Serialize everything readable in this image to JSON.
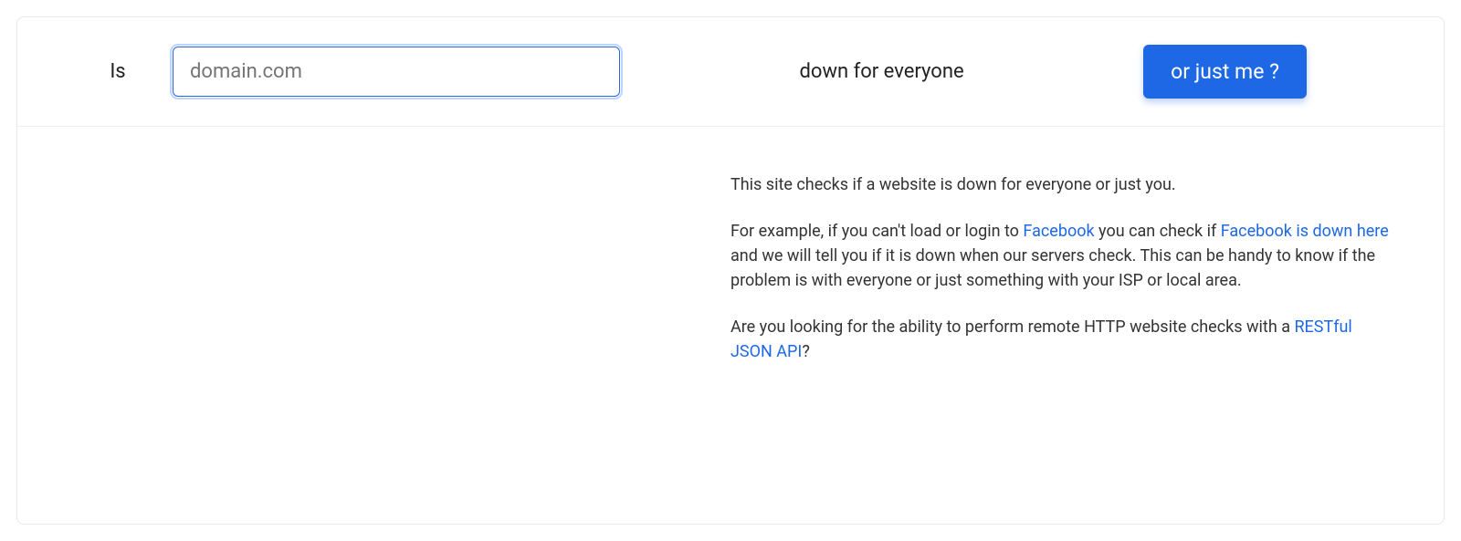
{
  "form": {
    "label_is": "Is",
    "domain_placeholder": "domain.com",
    "domain_value": "",
    "label_down": "down for everyone",
    "button_label": "or just me ?"
  },
  "description": {
    "p1": "This site checks if a website is down for everyone or just you.",
    "p2_a": "For example, if you can't load or login to ",
    "p2_link1": "Facebook",
    "p2_b": " you can check if ",
    "p2_link2": "Facebook is down here",
    "p2_c": " and we will tell you if it is down when our servers check. This can be handy to know if the problem is with everyone or just something with your ISP or local area.",
    "p3_a": "Are you looking for the ability to perform remote HTTP website checks with a ",
    "p3_link": "RESTful JSON API",
    "p3_b": "?"
  }
}
